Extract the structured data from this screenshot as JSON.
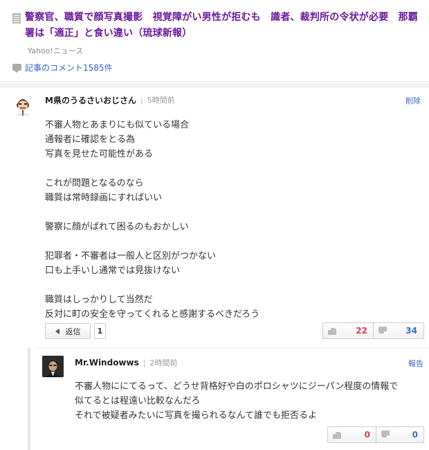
{
  "article": {
    "title": "警察官、職質で顔写真撮影　視覚障がい男性が拒むも　識者、裁判所の令状が必要　那覇署は「適正」と食い違い（琉球新報）",
    "source": "Yahoo!ニュース",
    "comment_count_label": "記事のコメント1585件"
  },
  "comments": [
    {
      "user": "M県のうるさいおじさん",
      "time": "5時間前",
      "action": "削除",
      "body": "不審人物とあまりにも似ている場合\n通報者に確認をとる為\n写真を見せた可能性がある\n\nこれが問題となるのなら\n職質は常時録画にすればいい\n\n警察に顔がばれて困るのもおかしい\n\n犯罪者・不審者は一般人と区別がつかない\n口も上手いし通常では見抜けない\n\n職質はしっかりして当然だ\n反対に町の安全を守ってくれると感謝するべきだろう",
      "reply_label": "返信",
      "reply_count": "1",
      "agree": "22",
      "disagree": "34"
    }
  ],
  "replies": [
    {
      "user": "Mr.Windowws",
      "time": "2時間前",
      "action": "報告",
      "body": "不審人物ににてるって、どうせ背格好や白のポロシャツにジーパン程度の情報で\n似てるとは程遠い比較なんだろ\nそれで被疑者みたいに写真を撮られるなんて誰でも拒否るよ",
      "agree": "0",
      "disagree": "0"
    }
  ],
  "colors": {
    "title": "#6a1b9a",
    "link": "#3366cc",
    "agree": "#e04040",
    "disagree": "#3a6fc8"
  },
  "icons": [
    "document-icon",
    "comment-bubble-icon",
    "reply-arrow-icon",
    "thumbs-up-icon",
    "thumbs-down-icon"
  ]
}
